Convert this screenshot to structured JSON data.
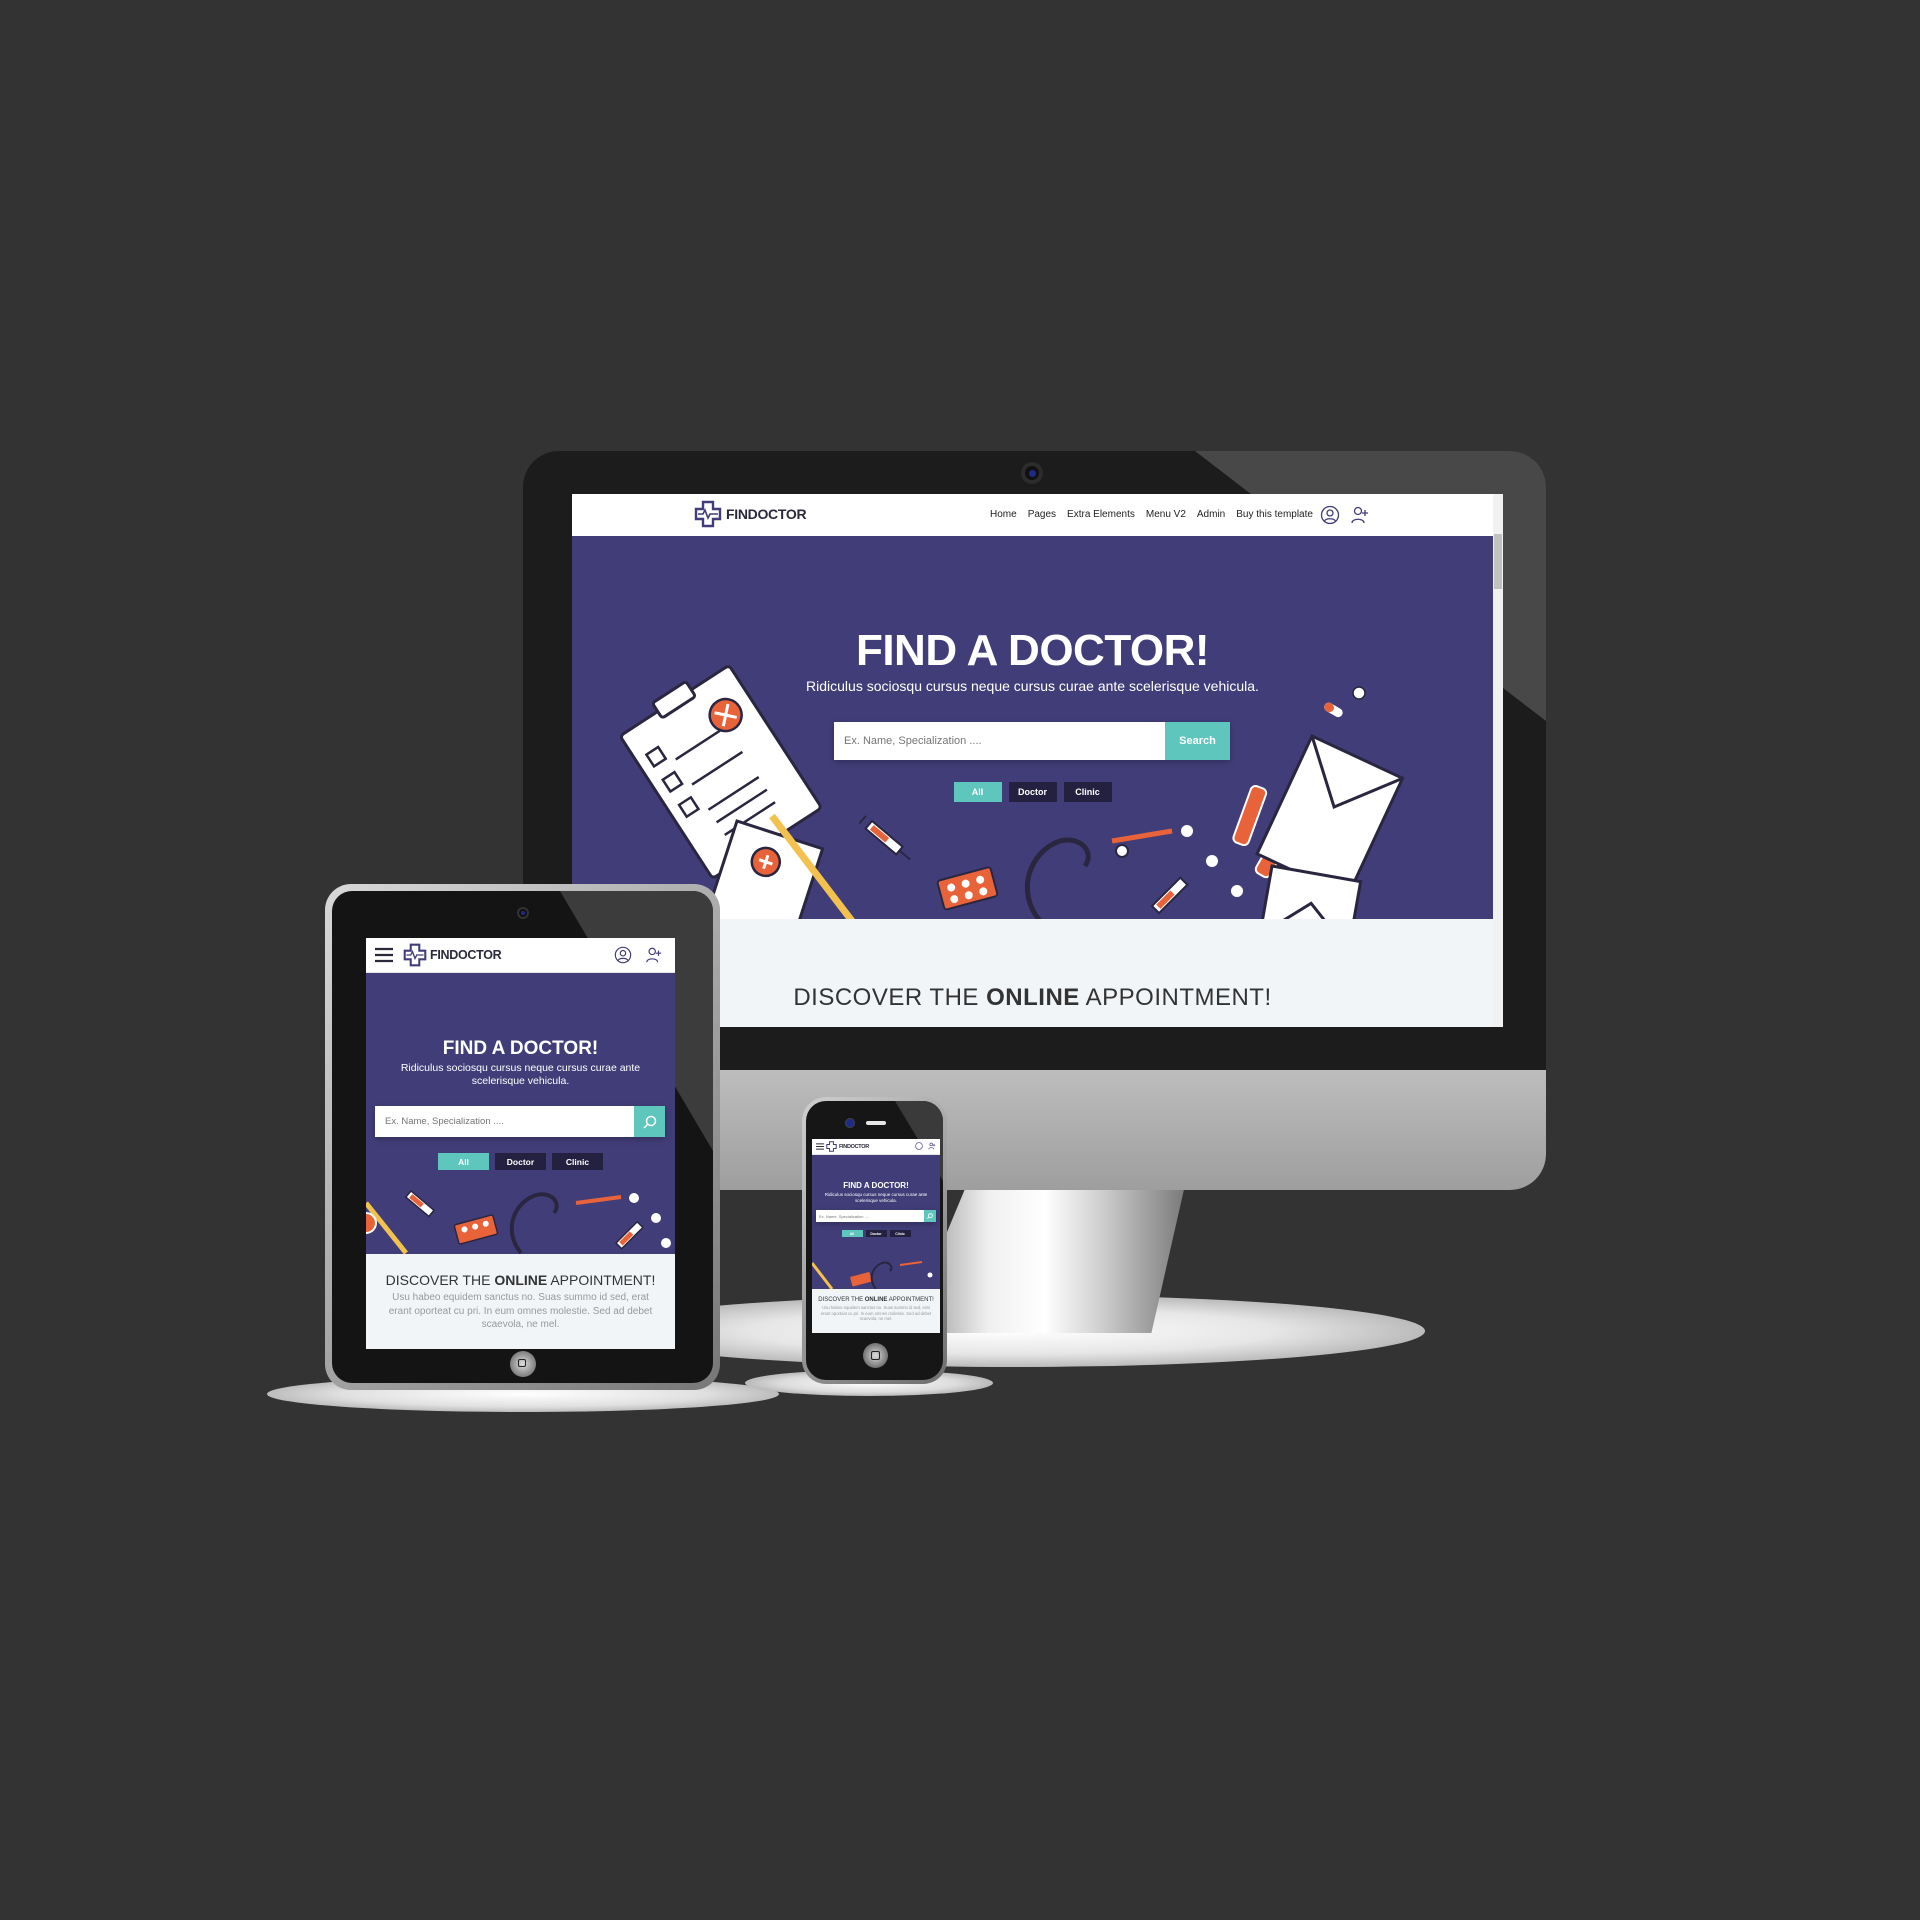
{
  "brand": {
    "name": "FINDOCTOR",
    "colors": {
      "hero_background": "#413d78",
      "accent": "#5fc6bd",
      "chip_dark": "#23213f",
      "page_background": "#333333"
    }
  },
  "nav": {
    "items": [
      "Home",
      "Pages",
      "Extra Elements",
      "Menu V2",
      "Admin",
      "Buy this template"
    ],
    "icons": [
      "user-icon",
      "add-user-icon",
      "hamburger-menu-icon"
    ]
  },
  "hero": {
    "title": "FIND A DOCTOR!",
    "subtitle": "Ridiculus sociosqu cursus neque cursus curae ante scelerisque vehicula.",
    "search": {
      "placeholder": "Ex. Name, Specialization ....",
      "button_label": "Search",
      "button_icon": "search-icon"
    },
    "filters": [
      {
        "label": "All",
        "active": true
      },
      {
        "label": "Doctor",
        "active": false
      },
      {
        "label": "Clinic",
        "active": false
      }
    ]
  },
  "discover": {
    "prefix": "DISCOVER THE",
    "highlight": "ONLINE",
    "suffix": "APPOINTMENT!",
    "body": "Usu habeo equidem sanctus no. Suas summo id sed, erat erant oporteat cu pri. In eum omnes molestie. Sed ad debet scaevola, ne mel."
  }
}
